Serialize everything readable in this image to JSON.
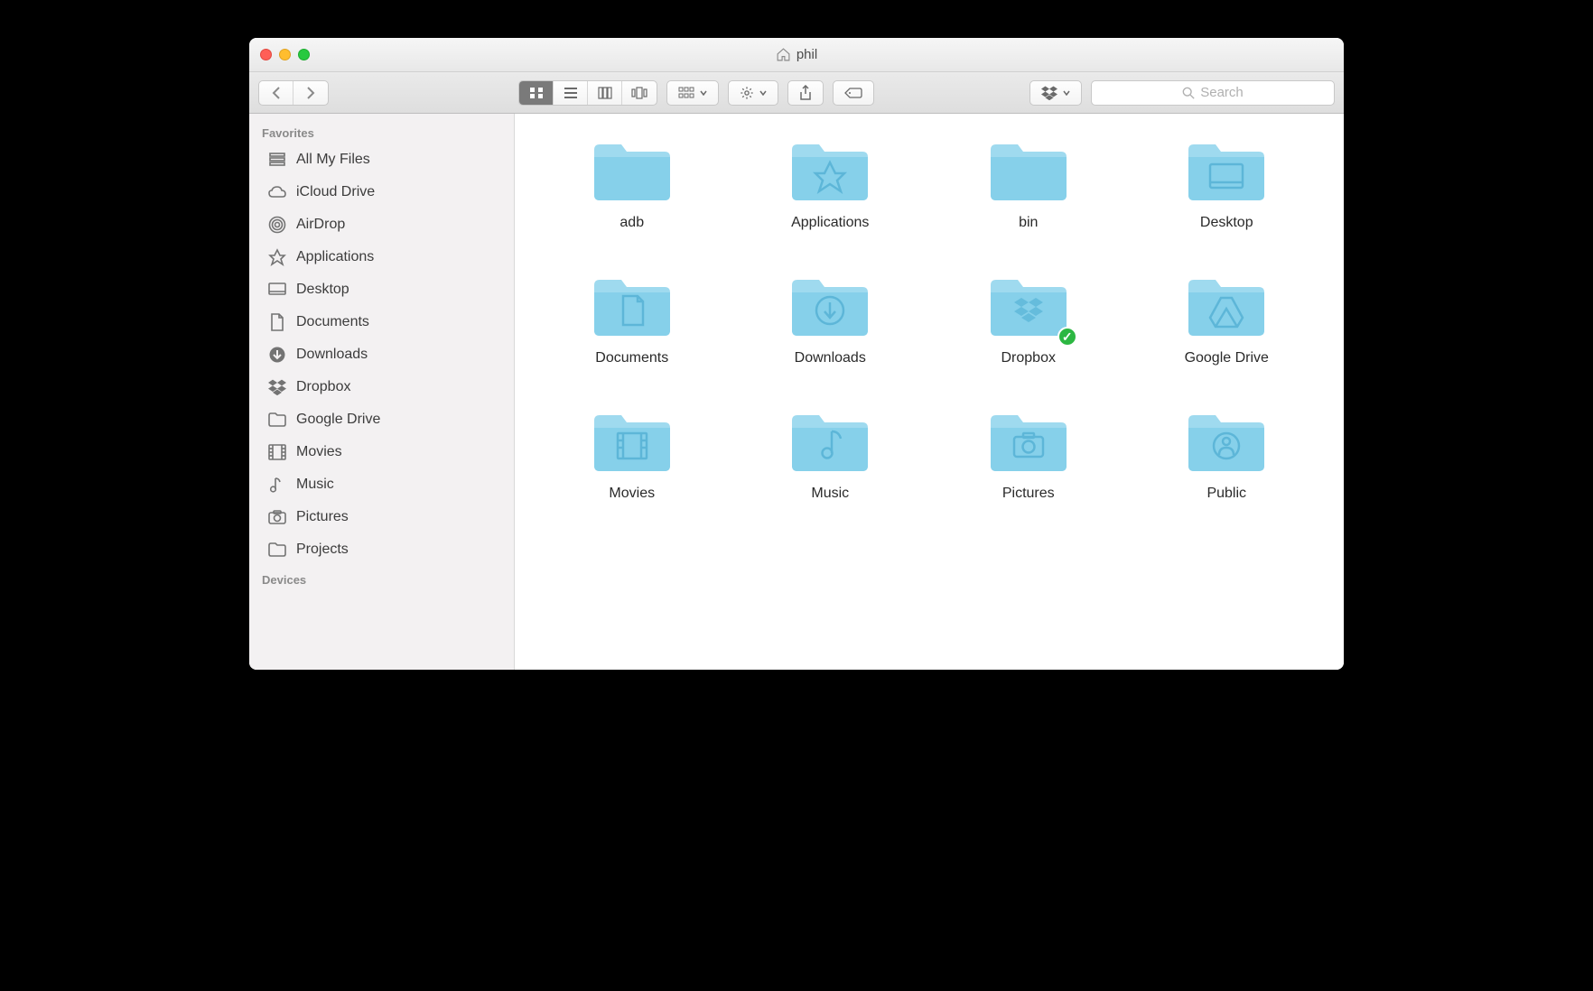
{
  "window": {
    "title": "phil"
  },
  "search": {
    "placeholder": "Search"
  },
  "sidebar": {
    "sections": [
      {
        "header": "Favorites",
        "items": [
          {
            "label": "All My Files",
            "icon": "all-my-files"
          },
          {
            "label": "iCloud Drive",
            "icon": "cloud"
          },
          {
            "label": "AirDrop",
            "icon": "airdrop"
          },
          {
            "label": "Applications",
            "icon": "applications"
          },
          {
            "label": "Desktop",
            "icon": "desktop"
          },
          {
            "label": "Documents",
            "icon": "documents"
          },
          {
            "label": "Downloads",
            "icon": "downloads"
          },
          {
            "label": "Dropbox",
            "icon": "dropbox"
          },
          {
            "label": "Google Drive",
            "icon": "folder"
          },
          {
            "label": "Movies",
            "icon": "movies"
          },
          {
            "label": "Music",
            "icon": "music"
          },
          {
            "label": "Pictures",
            "icon": "pictures"
          },
          {
            "label": "Projects",
            "icon": "folder"
          }
        ]
      },
      {
        "header": "Devices",
        "items": []
      }
    ]
  },
  "folders": [
    {
      "label": "adb",
      "glyph": "none",
      "badge": false
    },
    {
      "label": "Applications",
      "glyph": "apps",
      "badge": false
    },
    {
      "label": "bin",
      "glyph": "none",
      "badge": false
    },
    {
      "label": "Desktop",
      "glyph": "desktop",
      "badge": false
    },
    {
      "label": "Documents",
      "glyph": "documents",
      "badge": false
    },
    {
      "label": "Downloads",
      "glyph": "downloads",
      "badge": false
    },
    {
      "label": "Dropbox",
      "glyph": "dropbox",
      "badge": true
    },
    {
      "label": "Google Drive",
      "glyph": "gdrive",
      "badge": false
    },
    {
      "label": "Movies",
      "glyph": "movies",
      "badge": false
    },
    {
      "label": "Music",
      "glyph": "music",
      "badge": false
    },
    {
      "label": "Pictures",
      "glyph": "pictures",
      "badge": false
    },
    {
      "label": "Public",
      "glyph": "public",
      "badge": false
    }
  ]
}
